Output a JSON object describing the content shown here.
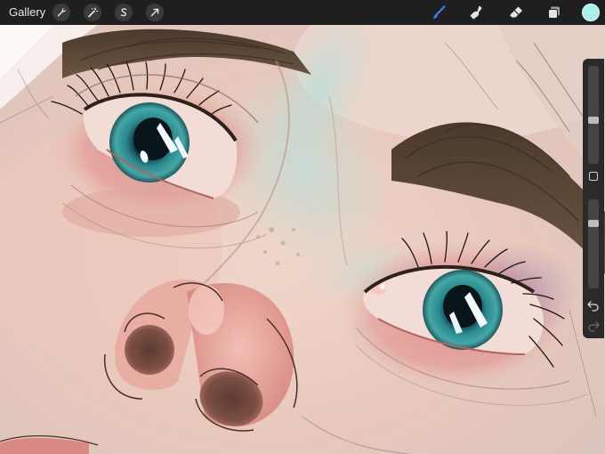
{
  "toolbar": {
    "gallery_label": "Gallery",
    "adjustment_tools": [
      {
        "name": "wrench-icon"
      },
      {
        "name": "magic-wand-icon"
      },
      {
        "name": "selection-s-icon"
      },
      {
        "name": "transform-arrow-icon"
      }
    ],
    "paint_tools": [
      {
        "name": "brush-icon",
        "active": true
      },
      {
        "name": "smudge-icon",
        "active": false
      },
      {
        "name": "eraser-icon",
        "active": false
      },
      {
        "name": "layers-icon",
        "active": false
      }
    ],
    "current_color": "#a8f0ea"
  },
  "sidebar": {
    "brush_size_level": 0.44,
    "opacity_level": 0.75,
    "modify_button": "square-icon",
    "undo_icon": "undo-icon",
    "redo_icon": "redo-icon"
  },
  "colors": {
    "toolbar_bg": "#1f1f1f",
    "accent_blue": "#3b82f6",
    "iris_teal": "#2f8a8d",
    "hair_brown": "#5a4633"
  }
}
